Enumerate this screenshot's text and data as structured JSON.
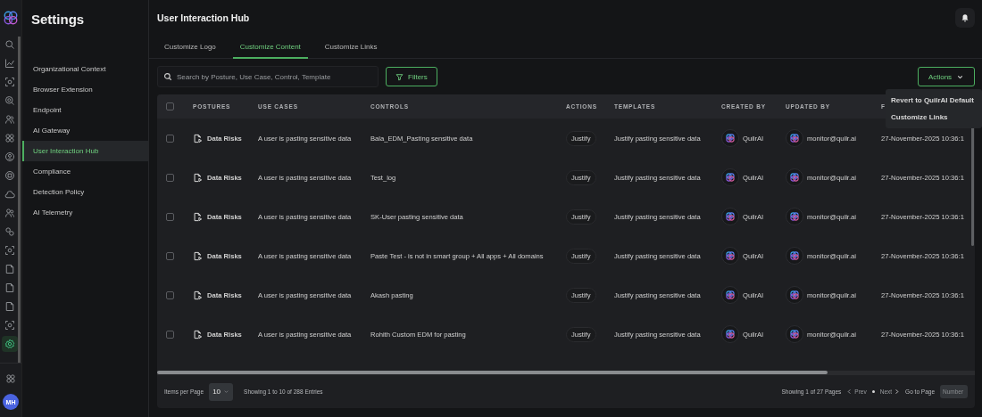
{
  "rail": {
    "items": [
      {
        "selected": false
      },
      {
        "selected": false
      },
      {
        "selected": false
      },
      {
        "selected": false
      },
      {
        "selected": false
      },
      {
        "selected": false
      },
      {
        "selected": false
      },
      {
        "selected": false
      },
      {
        "selected": false
      },
      {
        "selected": false
      },
      {
        "selected": false
      },
      {
        "selected": false
      },
      {
        "selected": false
      },
      {
        "selected": false
      },
      {
        "selected": false
      },
      {
        "selected": false
      },
      {
        "selected": true
      }
    ],
    "avatar": "MH"
  },
  "sidebar": {
    "title": "Settings",
    "items": [
      {
        "label": "Organizational Context",
        "selected": false
      },
      {
        "label": "Browser Extension",
        "selected": false
      },
      {
        "label": "Endpoint",
        "selected": false
      },
      {
        "label": "AI Gateway",
        "selected": false
      },
      {
        "label": "User Interaction Hub",
        "selected": true
      },
      {
        "label": "Compliance",
        "selected": false
      },
      {
        "label": "Detection Policy",
        "selected": false
      },
      {
        "label": "AI Telemetry",
        "selected": false
      }
    ]
  },
  "page": {
    "title": "User Interaction Hub"
  },
  "tabs": [
    {
      "label": "Customize Logo",
      "selected": false
    },
    {
      "label": "Customize Content",
      "selected": true
    },
    {
      "label": "Customize Links",
      "selected": false
    }
  ],
  "search": {
    "placeholder": "Search by Posture, Use Case, Control, Template"
  },
  "filters_button": "Filters",
  "actions_button": "Actions",
  "actions_menu": [
    "Revert to QuilrAI Default",
    "Customize Links"
  ],
  "table": {
    "header_checked": false,
    "columns": [
      "POSTURES",
      "USE CASES",
      "CONTROLS",
      "ACTIONS",
      "TEMPLATES",
      "CREATED BY",
      "UPDATED BY",
      "F"
    ],
    "rows": [
      {
        "checked": false,
        "posture": "Data Risks",
        "use_case": "A user is pasting sensitive data",
        "control": "Bala_EDM_Pasting sensitive data",
        "action": "Justify",
        "template": "Justify pasting sensitive data",
        "created_by": "QuilrAI",
        "updated_by": "monitor@quilr.ai",
        "column_8": "27-November-2025 10:36:1"
      },
      {
        "checked": false,
        "posture": "Data Risks",
        "use_case": "A user is pasting sensitive data",
        "control": "Test_log",
        "action": "Justify",
        "template": "Justify pasting sensitive data",
        "created_by": "QuilrAI",
        "updated_by": "monitor@quilr.ai",
        "column_8": "27-November-2025 10:36:1"
      },
      {
        "checked": false,
        "posture": "Data Risks",
        "use_case": "A user is pasting sensitive data",
        "control": "SK-User pasting sensitive data",
        "action": "Justify",
        "template": "Justify pasting sensitive data",
        "created_by": "QuilrAI",
        "updated_by": "monitor@quilr.ai",
        "column_8": "27-November-2025 10:36:1"
      },
      {
        "checked": false,
        "posture": "Data Risks",
        "use_case": "A user is pasting sensitive data",
        "control": "Paste Test - is not in smart group + All apps + All domains",
        "action": "Justify",
        "template": "Justify pasting sensitive data",
        "created_by": "QuilrAI",
        "updated_by": "monitor@quilr.ai",
        "column_8": "27-November-2025 10:36:1"
      },
      {
        "checked": false,
        "posture": "Data Risks",
        "use_case": "A user is pasting sensitive data",
        "control": "Akash pasting",
        "action": "Justify",
        "template": "Justify pasting sensitive data",
        "created_by": "QuilrAI",
        "updated_by": "monitor@quilr.ai",
        "column_8": "27-November-2025 10:36:1"
      },
      {
        "checked": false,
        "posture": "Data Risks",
        "use_case": "A user is pasting sensitive data",
        "control": "Rohith Custom EDM for pasting",
        "action": "Justify",
        "template": "Justify pasting sensitive data",
        "created_by": "QuilrAI",
        "updated_by": "monitor@quilr.ai",
        "column_8": "27-November-2025 10:36:1"
      }
    ]
  },
  "footer": {
    "items_per_page_label": "Items per Page",
    "items_per_page": "10",
    "entries": "Showing 1 to 10 of 288 Entries",
    "pages": "Showing 1 of 27 Pages",
    "prev": "Prev",
    "next": "Next",
    "goto_label": "Go to Page",
    "goto_placeholder": "Number"
  }
}
